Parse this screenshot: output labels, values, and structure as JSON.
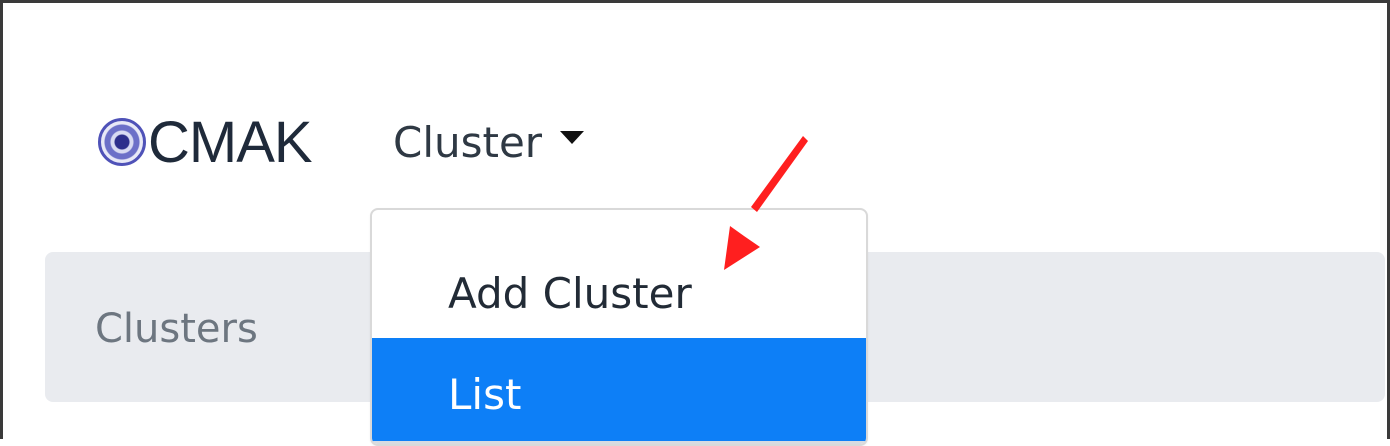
{
  "brand": {
    "name": "CMAK",
    "logo_icon": "target-icon"
  },
  "navbar": {
    "cluster_label": "Cluster",
    "caret_icon": "caret-down-icon"
  },
  "breadcrumb": {
    "label": "Clusters"
  },
  "dropdown": {
    "items": [
      {
        "label": "Add Cluster",
        "active": false
      },
      {
        "label": "List",
        "active": true
      }
    ]
  },
  "annotation": {
    "arrow_icon": "red-arrow-icon",
    "target": "Add Cluster",
    "color": "#ff1f1f"
  },
  "colors": {
    "active_item": "#0d7ff7",
    "breadcrumb_bg": "#e9ebef",
    "brand_text": "#1f2a3a"
  }
}
